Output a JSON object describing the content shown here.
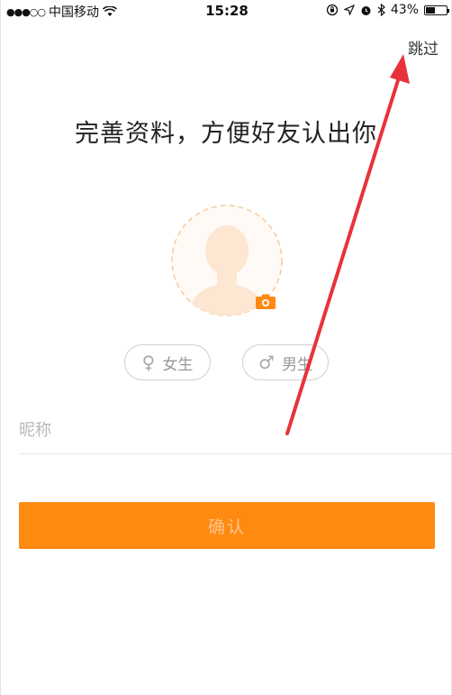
{
  "status_bar": {
    "signal": "●●●○○",
    "carrier": "中国移动",
    "time": "15:28",
    "battery": "43%"
  },
  "header": {
    "skip_label": "跳过"
  },
  "main": {
    "title": "完善资料，方便好友认出你",
    "gender_options": [
      {
        "symbol": "♀",
        "label": "女生"
      },
      {
        "symbol": "♂",
        "label": "男生"
      }
    ],
    "nickname": {
      "placeholder": "昵称",
      "value": ""
    },
    "confirm_label": "确认"
  },
  "colors": {
    "accent": "#ff8a12",
    "avatar_tint": "#fde6d2",
    "annotation_arrow": "#e8323a"
  },
  "icons": [
    "wifi-icon",
    "orientation-lock-icon",
    "location-icon",
    "alarm-icon",
    "bluetooth-icon",
    "battery-icon",
    "avatar-placeholder-icon",
    "camera-icon"
  ]
}
